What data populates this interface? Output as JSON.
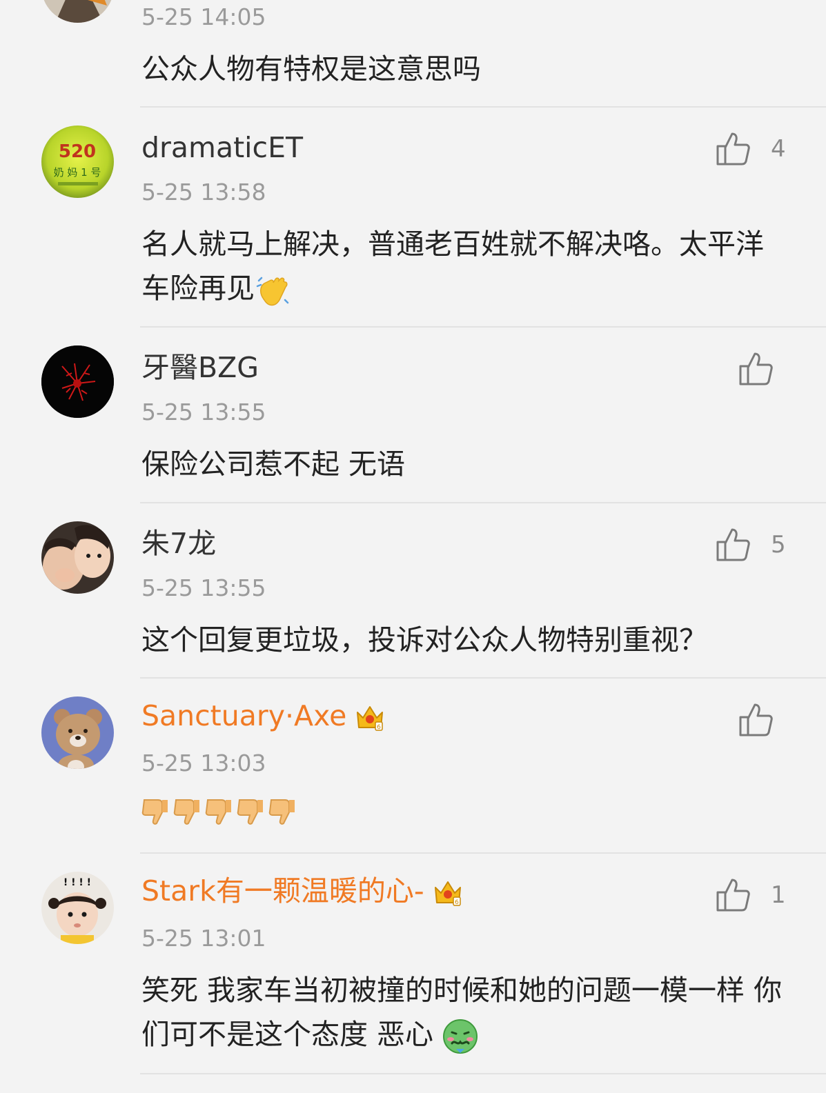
{
  "comments": [
    {
      "username": "",
      "time": "5-25 14:05",
      "text": "公众人物有特权是这意思吗",
      "likes": ""
    },
    {
      "username": "dramaticET",
      "avatar_text": "520",
      "avatar_sub": "奶 妈 1 号",
      "time": "5-25 13:58",
      "text": "名人就马上解决，普通老百姓就不解决咯。太平洋车险再见",
      "emoji": "waving-hand",
      "likes": "4"
    },
    {
      "username": "牙醫BZG",
      "time": "5-25 13:55",
      "text": "保险公司惹不起 无语",
      "likes": ""
    },
    {
      "username": "朱7龙",
      "time": "5-25 13:55",
      "text": "这个回复更垃圾，投诉对公众人物特别重视？",
      "likes": "5"
    },
    {
      "username": "Sanctuary·Axe",
      "vip": true,
      "time": "5-25 13:03",
      "text": "",
      "emoji": "thumbs-down x5",
      "likes": ""
    },
    {
      "username": "Stark有一颗温暖的心-",
      "vip": true,
      "avatar_text": "! ! ! !",
      "time": "5-25 13:01",
      "text": "笑死 我家车当初被撞的时候和她的问题一模一样 你们可不是这个态度 恶心",
      "emoji": "nauseated-face",
      "likes": "1"
    }
  ],
  "colors": {
    "background": "#f3f3f3",
    "vip_name": "#f07a24",
    "time": "#9a9a9a"
  }
}
